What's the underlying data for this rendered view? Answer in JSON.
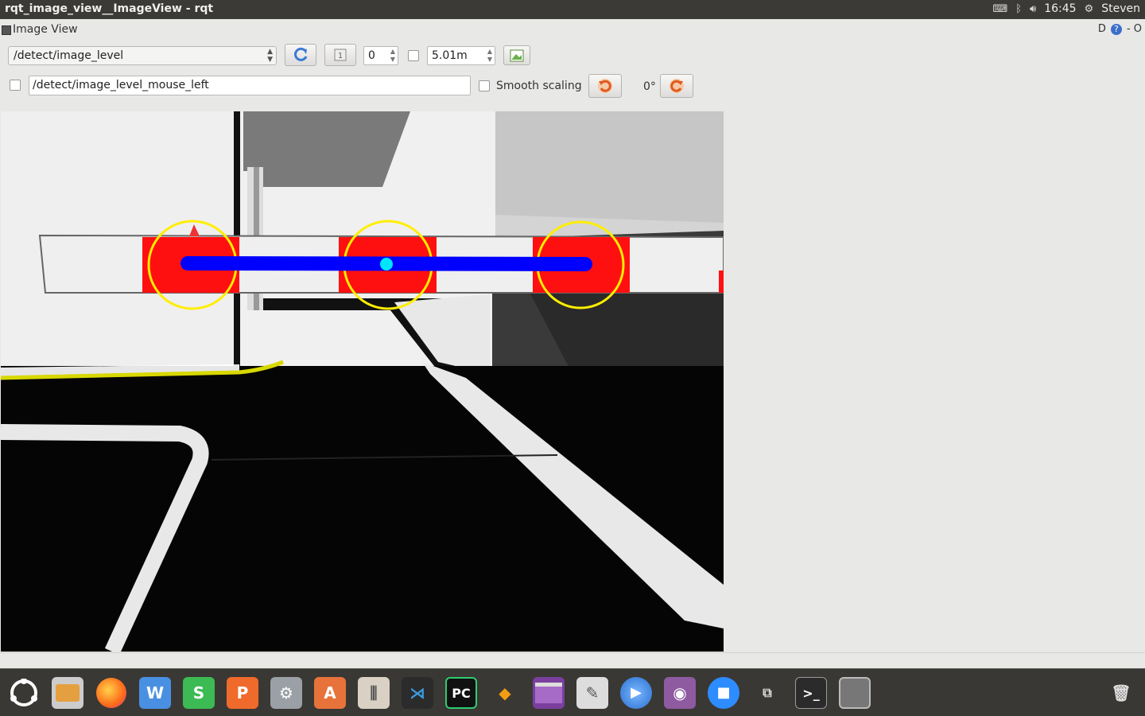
{
  "window": {
    "title": "rqt_image_view__ImageView - rqt"
  },
  "system_tray": {
    "time": "16:45",
    "user": "Steven"
  },
  "dock": {
    "title": "Image View",
    "buttons_text": "D",
    "close": "- O"
  },
  "toolbar": {
    "topic": "/detect/image_level",
    "spin_value": "0",
    "duration_value": "5.01m",
    "mouse_topic": "/detect/image_level_mouse_left",
    "smooth_scaling_label": "Smooth scaling",
    "rotation_label": "0°"
  },
  "colors": {
    "accent_orange": "#e05a1e",
    "refresh_blue": "#3a7bd5",
    "mark_red": "#ff1010",
    "mark_yellow": "#ffee00",
    "mark_blue": "#0000ff",
    "mark_cyan": "#00e5ff"
  },
  "launcher": {
    "apps": [
      "ubuntu-icon",
      "files-icon",
      "firefox-icon",
      "wps-writer-icon",
      "wps-spreadsheets-icon",
      "wps-presentation-icon",
      "system-settings-icon",
      "software-center-icon",
      "mixer-icon",
      "vscode-icon",
      "pycharm-icon",
      "sublime-icon",
      "window-icon",
      "image-viewer-icon",
      "media-player-icon",
      "video-icon",
      "zoom-icon",
      "workspace-switcher-icon",
      "terminal-icon",
      "blank-window-icon",
      "trash-icon"
    ]
  }
}
